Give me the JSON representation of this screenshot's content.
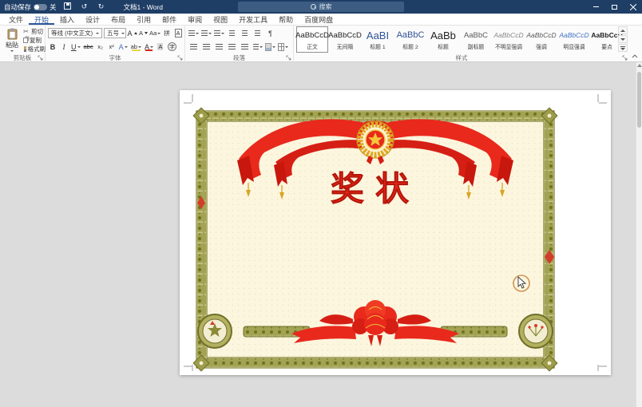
{
  "titlebar": {
    "autosave_label": "自动保存",
    "autosave_state": "关",
    "doc_title": "文档1 - Word",
    "search_placeholder": "搜索"
  },
  "tabs": [
    {
      "label": "文件"
    },
    {
      "label": "开始"
    },
    {
      "label": "插入"
    },
    {
      "label": "设计"
    },
    {
      "label": "布局"
    },
    {
      "label": "引用"
    },
    {
      "label": "邮件"
    },
    {
      "label": "审阅"
    },
    {
      "label": "视图"
    },
    {
      "label": "开发工具"
    },
    {
      "label": "帮助"
    },
    {
      "label": "百度网盘"
    }
  ],
  "ribbon": {
    "clipboard": {
      "group_label": "剪贴板",
      "paste": "粘贴",
      "cut": "剪切",
      "copy": "复制",
      "painter": "格式刷"
    },
    "font": {
      "group_label": "字体",
      "family": "等线 (中文正文)",
      "size": "五号",
      "grow": "A",
      "shrink": "A",
      "case": "Aa",
      "pinyin": "拼",
      "char_border": "A",
      "bold": "B",
      "italic": "I",
      "underline": "U",
      "strike": "abc",
      "subscript": "x₂",
      "superscript": "x²",
      "effects": "A",
      "highlight": "ab",
      "color": "A",
      "shading": "A",
      "enclose": "字"
    },
    "paragraph": {
      "group_label": "段落"
    },
    "styles": {
      "group_label": "样式",
      "items": [
        {
          "sample": "AaBbCcD",
          "name": "正文"
        },
        {
          "sample": "AaBbCcD",
          "name": "无间隔"
        },
        {
          "sample": "AaBI",
          "name": "标题 1"
        },
        {
          "sample": "AaBbC",
          "name": "标题 2"
        },
        {
          "sample": "AaBb",
          "name": "标题"
        },
        {
          "sample": "AaBbC",
          "name": "副标题"
        },
        {
          "sample": "AaBbCcD",
          "name": "不明显强调"
        },
        {
          "sample": "AaBbCcD",
          "name": "强调"
        },
        {
          "sample": "AaBbCcD",
          "name": "明显强调"
        },
        {
          "sample": "AaBbCcD",
          "name": "要点"
        }
      ]
    }
  },
  "document": {
    "award_title": "奖状"
  },
  "icons": {
    "undo": "↺",
    "redo": "↻",
    "scissors": "✂",
    "pilcrow": "¶"
  },
  "colors": {
    "titlebar": "#1e3e66",
    "accent": "#2b579a",
    "award_red": "#e8291c",
    "border_gold": "#9c9c4a",
    "page_cream": "#fcf6df"
  }
}
